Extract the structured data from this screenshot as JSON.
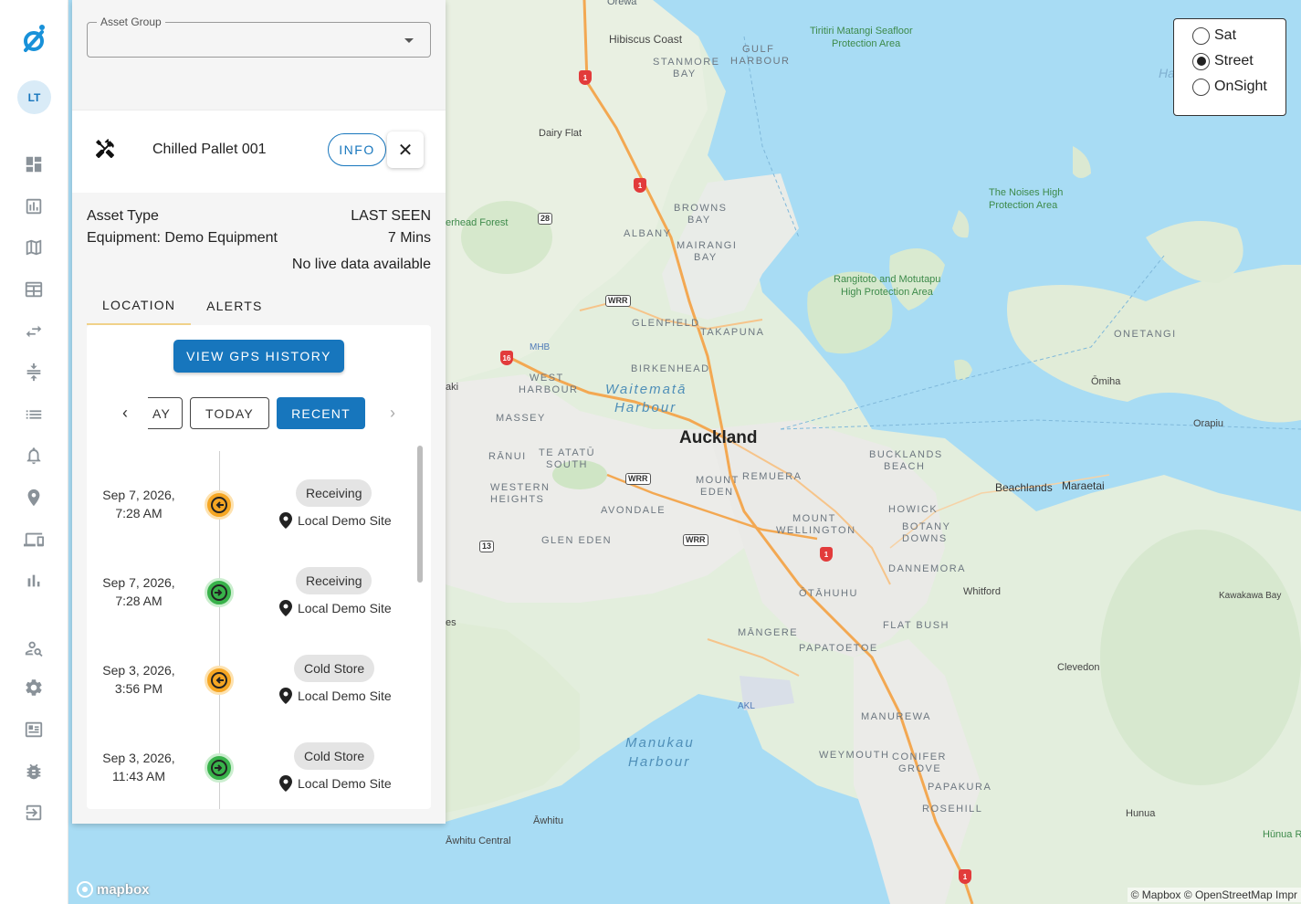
{
  "app": {
    "logo_icon": "orbit-logo-icon",
    "avatar_initials": "LT",
    "accent": "#1776bd"
  },
  "nav": {
    "items": [
      {
        "name": "dashboard-icon"
      },
      {
        "name": "reports-icon"
      },
      {
        "name": "map-icon"
      },
      {
        "name": "table-icon"
      },
      {
        "name": "transfer-icon"
      },
      {
        "name": "compare-icon"
      },
      {
        "name": "list-icon"
      },
      {
        "name": "bell-icon"
      },
      {
        "name": "location-pin-icon"
      },
      {
        "name": "devices-icon"
      },
      {
        "name": "bar-chart-icon"
      },
      {
        "name": "user-settings-icon"
      },
      {
        "name": "gear-icon"
      },
      {
        "name": "id-card-icon"
      },
      {
        "name": "bug-icon"
      },
      {
        "name": "logout-icon"
      }
    ]
  },
  "panel": {
    "asset_group_label": "Asset Group",
    "asset_group_value": "",
    "asset_name": "Chilled Pallet 001",
    "info_label": "INFO",
    "close_label": "✕",
    "asset_type_label": "Asset Type",
    "asset_type_value": "Equipment: Demo Equipment",
    "last_seen_label": "LAST SEEN",
    "last_seen_value": "7 Mins",
    "live_data_status": "No live data available",
    "tabs": [
      {
        "label": "LOCATION",
        "active": true
      },
      {
        "label": "ALERTS",
        "active": false
      }
    ],
    "gps_button_label": "VIEW GPS HISTORY",
    "filters": {
      "partial_label": "AY",
      "today_label": "TODAY",
      "recent_label": "RECENT"
    },
    "events": [
      {
        "date": "Sep 7, 2026,",
        "time": "7:28 AM",
        "type": "exit",
        "location_name": "Receiving",
        "site": "Local Demo Site"
      },
      {
        "date": "Sep 7, 2026,",
        "time": "7:28 AM",
        "type": "enter",
        "location_name": "Receiving",
        "site": "Local Demo Site"
      },
      {
        "date": "Sep 3, 2026,",
        "time": "3:56 PM",
        "type": "exit",
        "location_name": "Cold Store",
        "site": "Local Demo Site"
      },
      {
        "date": "Sep 3, 2026,",
        "time": "11:43 AM",
        "type": "enter",
        "location_name": "Cold Store",
        "site": "Local Demo Site"
      }
    ]
  },
  "map": {
    "layer_options": [
      {
        "label": "Sat",
        "selected": false
      },
      {
        "label": "Street",
        "selected": true
      },
      {
        "label": "OnSight",
        "selected": false
      }
    ],
    "city": "Auckland",
    "labels": {
      "orewa": "Orewa",
      "hibiscus": "Hibiscus Coast",
      "stanmore": "STANMORE",
      "bay1": "BAY",
      "gulf": "GULF",
      "harbour1": "HARBOUR",
      "tiritiri1": "Tiritiri Matangi Seafloor",
      "tiritiri2": "Protection Area",
      "dairyflat": "Dairy Flat",
      "forest": "erhead Forest",
      "browns": "BROWNS",
      "bay2": "BAY",
      "albany": "ALBANY",
      "mairangi": "MAIRANGI",
      "bay3": "BAY",
      "noises1": "The Noises High",
      "noises2": "Protection Area",
      "rangitoto1": "Rangitoto and Motutapu",
      "rangitoto2": "High Protection Area",
      "glenfield": "GLENFIELD",
      "takapuna": "TAKAPUNA",
      "mhb": "MHB",
      "birkenhead": "BIRKENHEAD",
      "westh1": "WEST",
      "westh2": "HARBOUR",
      "waitemata1": "Waitematā",
      "waitemata2": "Harbour",
      "onetangi": "ONETANGI",
      "omiha": "Ōmiha",
      "orapiu": "Orapiu",
      "aki": "aki",
      "massey": "MASSEY",
      "ranui": "RĀNUI",
      "teatatu1": "TE ATATŪ",
      "teatatu2": "SOUTH",
      "buckland1": "BUCKLANDS",
      "buckland2": "BEACH",
      "beachlands": "Beachlands",
      "maraetai": "Maraetai",
      "westernh1": "WESTERN",
      "westernh2": "HEIGHTS",
      "avondale": "AVONDALE",
      "mteden1": "MOUNT",
      "mteden2": "EDEN",
      "remuera": "REMUERA",
      "howick": "HOWICK",
      "botany1": "BOTANY",
      "botany2": "DOWNS",
      "mtwell1": "MOUNT",
      "mtwell2": "WELLINGTON",
      "gleneden": "GLEN EDEN",
      "dannemora": "DANNEMORA",
      "whitford": "Whitford",
      "kawakawa": "Kawakawa Bay",
      "otahuhu": "ŌTĀHUHU",
      "es": "es",
      "flatbush": "FLAT BUSH",
      "mangere": "MĀNGERE",
      "papatoetoe": "PAPATOETOE",
      "clevedon": "Clevedon",
      "akl": "AKL",
      "manurewa": "MANUREWA",
      "manukau1": "Manukau",
      "manukau2": "Harbour",
      "weymouth": "WEYMOUTH",
      "conifer1": "CONIFER",
      "conifer2": "GROVE",
      "papakura": "PAPAKURA",
      "rosehill": "ROSEHILL",
      "hunua": "Hunua",
      "hunuar": "Hūnua R",
      "awhitu": "Āwhitu",
      "awhituc": "Āwhitu Central",
      "ha": "Ha"
    },
    "shields": {
      "s1": "1",
      "s16": "16",
      "s28": "28",
      "s13": "13",
      "wrr": "WRR"
    },
    "mapbox_logo": "mapbox",
    "attribution": "© Mapbox © OpenStreetMap  Impr"
  }
}
